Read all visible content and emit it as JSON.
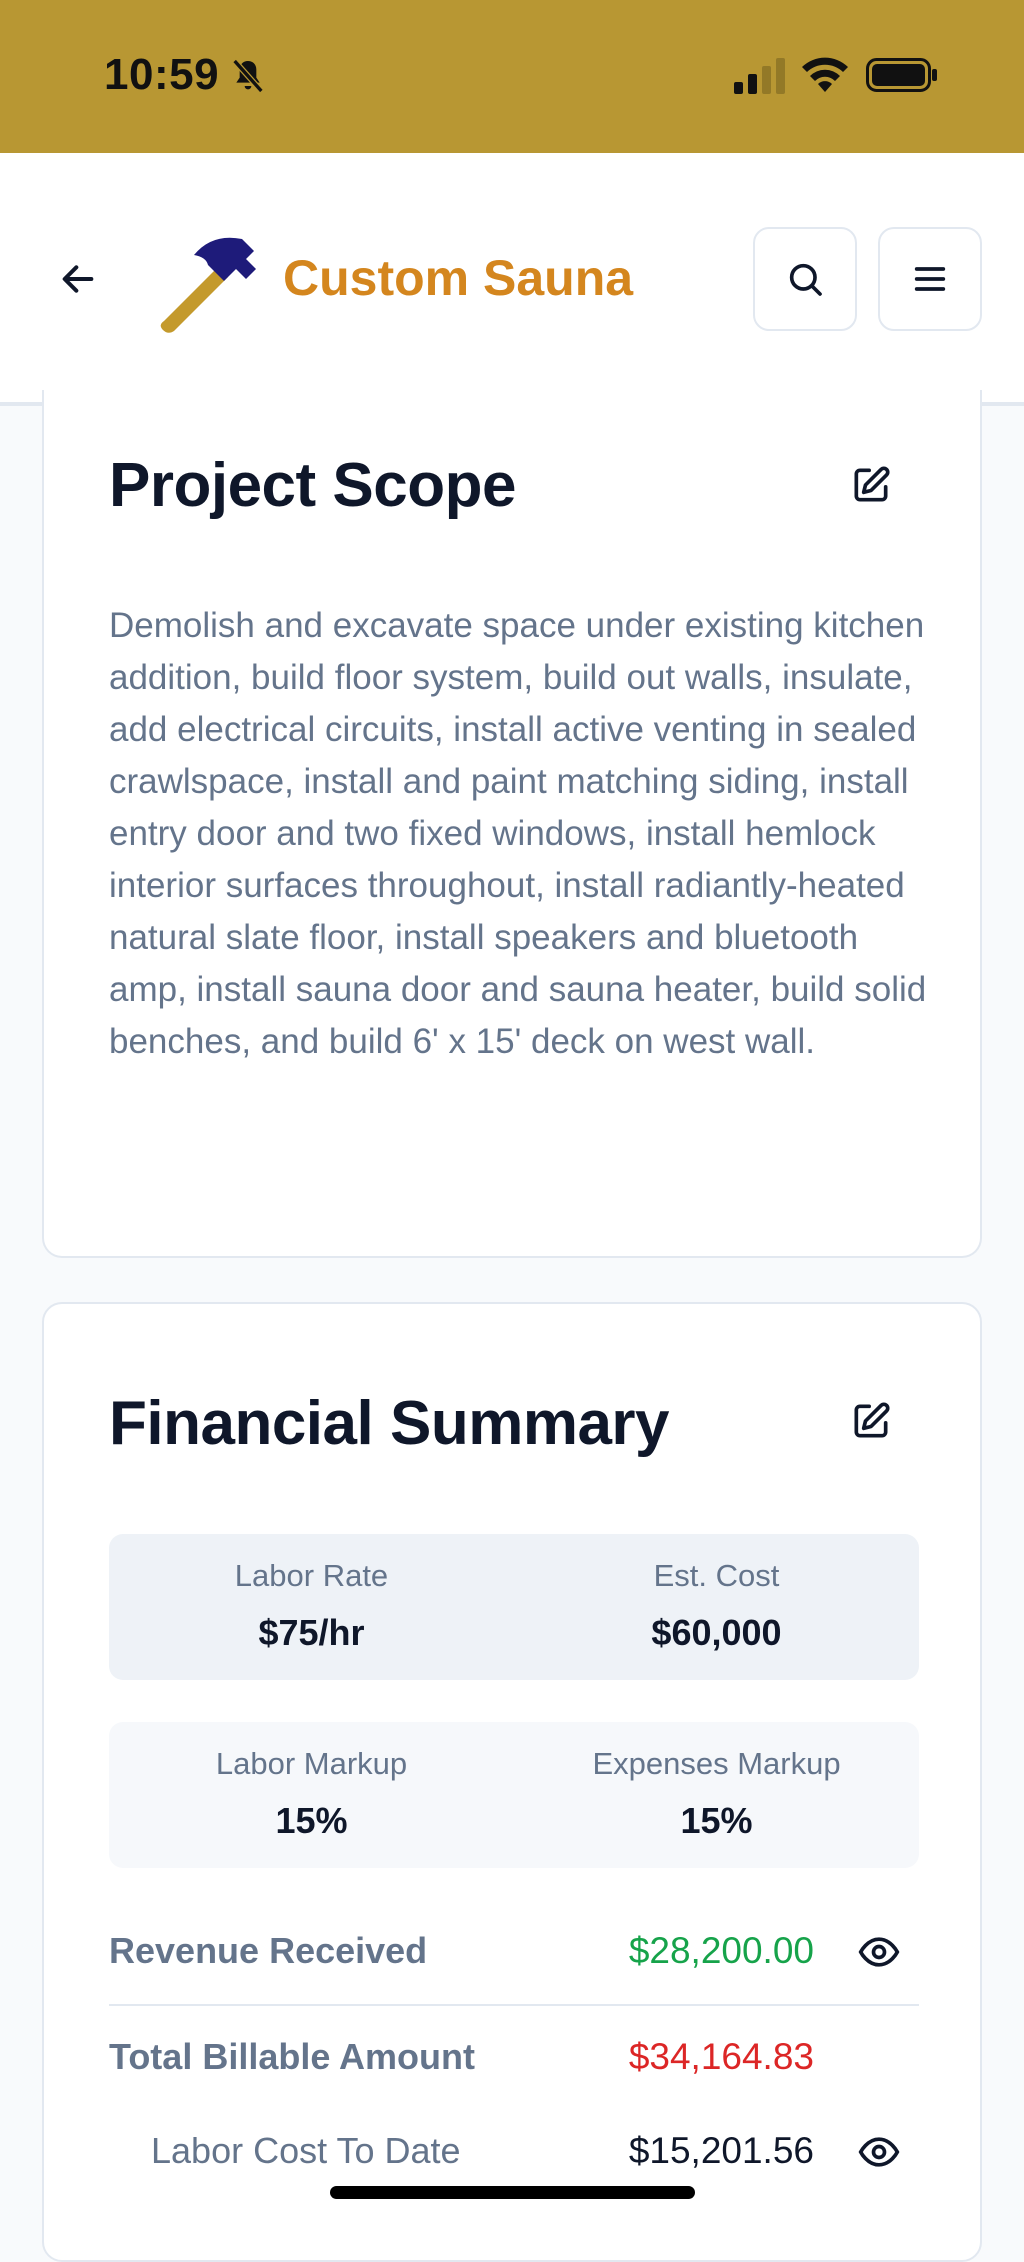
{
  "status_bar": {
    "time": "10:59",
    "background": "#b89733"
  },
  "header": {
    "title": "Custom Sauna",
    "title_color": "#d4861e",
    "logo_icon": "hammer-icon",
    "back_icon": "arrow-left-icon",
    "search_icon": "search-icon",
    "menu_icon": "menu-icon"
  },
  "scope": {
    "title": "Project Scope",
    "description": "Demolish and excavate space under existing kitchen addition, build floor system, build out walls, insulate, add electrical circuits, install active venting in sealed crawlspace, install and paint matching siding, install entry door and two fixed windows, install hemlock interior surfaces throughout, install radiantly-heated natural slate floor, install speakers and bluetooth amp, install sauna door and sauna heater, build solid benches, and build 6' x 15' deck on west wall."
  },
  "financial": {
    "title": "Financial Summary",
    "labor_rate": {
      "label": "Labor Rate",
      "value": "$75/hr"
    },
    "est_cost": {
      "label": "Est. Cost",
      "value": "$60,000"
    },
    "labor_markup": {
      "label": "Labor Markup",
      "value": "15%"
    },
    "expenses_markup": {
      "label": "Expenses Markup",
      "value": "15%"
    },
    "revenue_received": {
      "label": "Revenue Received",
      "value": "$28,200.00",
      "color": "#16a34a"
    },
    "total_billable": {
      "label": "Total Billable Amount",
      "value": "$34,164.83",
      "color": "#dc2626"
    },
    "labor_cost_to_date": {
      "label": "Labor Cost To Date",
      "value": "$15,201.56"
    }
  }
}
